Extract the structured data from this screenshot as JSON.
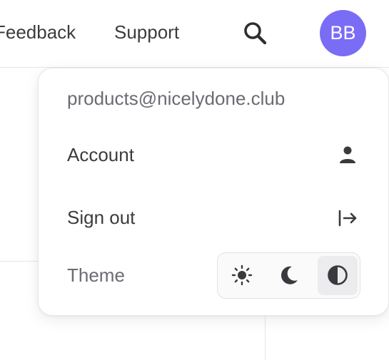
{
  "nav": {
    "feedback": "Feedback",
    "support": "Support",
    "search_icon": "search-icon",
    "avatar_initials": "BB",
    "avatar_color": "#7b6cf6"
  },
  "menu": {
    "email": "products@nicelydone.club",
    "account_label": "Account",
    "account_icon": "user-icon",
    "signout_label": "Sign out",
    "signout_icon": "sign-out-icon",
    "theme_label": "Theme",
    "theme_options": [
      {
        "icon": "sun-icon",
        "selected": false
      },
      {
        "icon": "moon-icon",
        "selected": false
      },
      {
        "icon": "contrast-icon",
        "selected": true
      }
    ]
  }
}
